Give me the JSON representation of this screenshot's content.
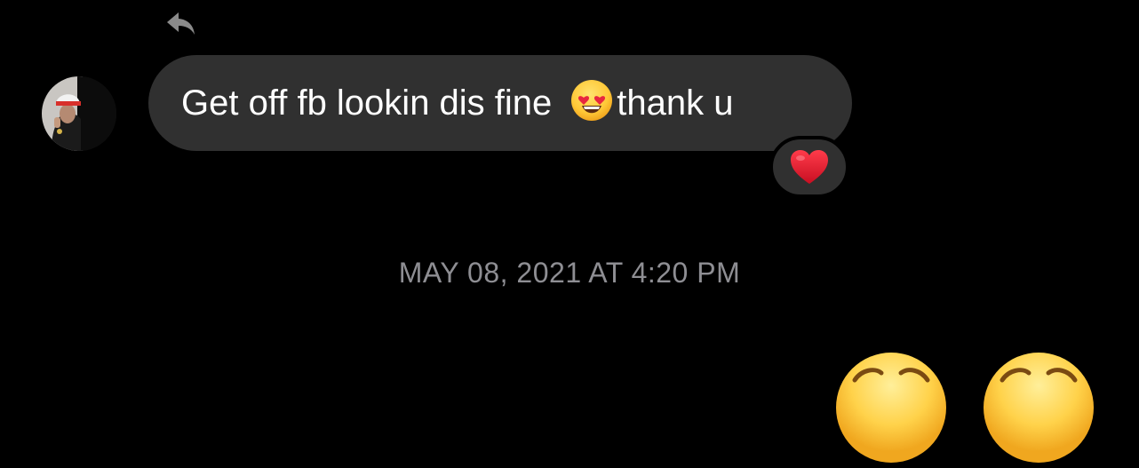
{
  "message": {
    "text_before_emoji": "Get off fb lookin dis fine",
    "inline_emoji": "heart-eyes-emoji",
    "text_after_emoji": "thank u",
    "reaction": "red-heart-emoji",
    "reply_icon": "reply-arrow-icon",
    "sender_avatar": "profile-avatar"
  },
  "timestamp": "MAY 08, 2021 AT 4:20 PM",
  "next_message": {
    "emojis": [
      "partial-emoji",
      "partial-emoji"
    ]
  },
  "colors": {
    "background": "#000000",
    "bubble": "#303030",
    "text": "#ffffff",
    "timestamp": "#8e8e93",
    "heart": "#e0162b"
  }
}
